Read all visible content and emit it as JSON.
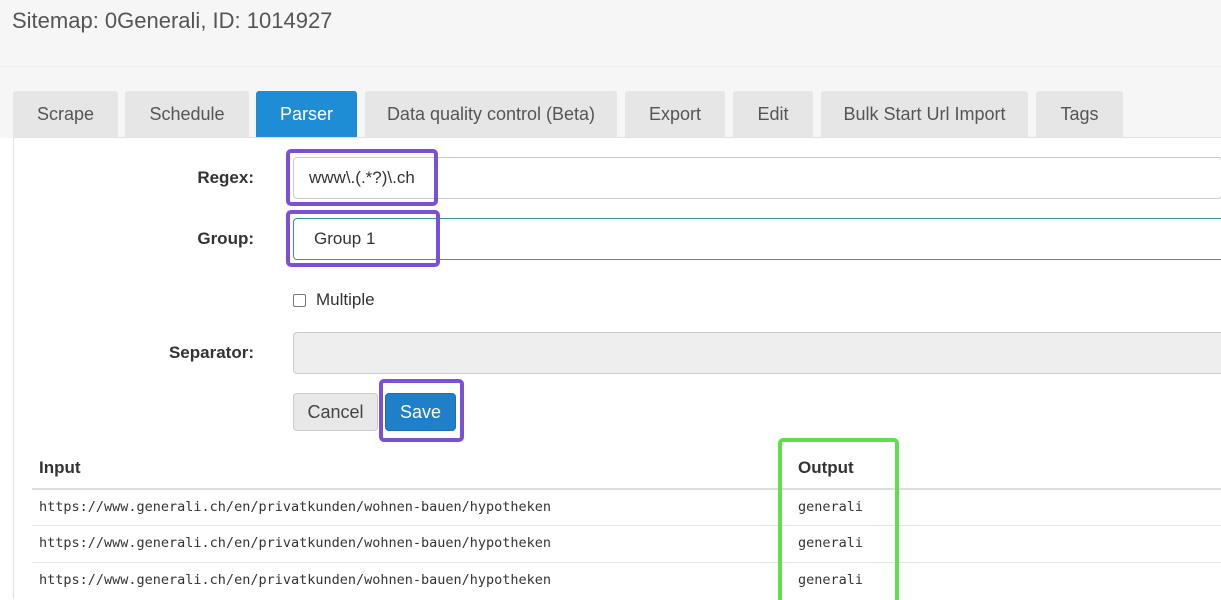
{
  "header": {
    "title": "Sitemap: 0Generali, ID: 1014927"
  },
  "tabs": [
    {
      "label": "Scrape",
      "active": false
    },
    {
      "label": "Schedule",
      "active": false
    },
    {
      "label": "Parser",
      "active": true
    },
    {
      "label": "Data quality control (Beta)",
      "active": false
    },
    {
      "label": "Export",
      "active": false
    },
    {
      "label": "Edit",
      "active": false
    },
    {
      "label": "Bulk Start Url Import",
      "active": false
    },
    {
      "label": "Tags",
      "active": false
    }
  ],
  "form": {
    "regex": {
      "label": "Regex:",
      "value": "www\\.(.*?)\\.ch"
    },
    "group": {
      "label": "Group:",
      "value": "Group 1"
    },
    "multiple": {
      "label": "Multiple",
      "checked": false
    },
    "separator": {
      "label": "Separator:",
      "value": ""
    },
    "cancel_label": "Cancel",
    "save_label": "Save"
  },
  "table": {
    "columns": [
      "Input",
      "Output"
    ],
    "rows": [
      {
        "input": "https://www.generali.ch/en/privatkunden/wohnen-bauen/hypotheken",
        "output": "generali"
      },
      {
        "input": "https://www.generali.ch/en/privatkunden/wohnen-bauen/hypotheken",
        "output": "generali"
      },
      {
        "input": "https://www.generali.ch/en/privatkunden/wohnen-bauen/hypotheken",
        "output": "generali"
      }
    ]
  },
  "colors": {
    "active_tab": "#1f8dd6",
    "save_button": "#1f7fc8",
    "annotation_purple": "#7b4fd6",
    "annotation_green": "#5fe04a"
  }
}
